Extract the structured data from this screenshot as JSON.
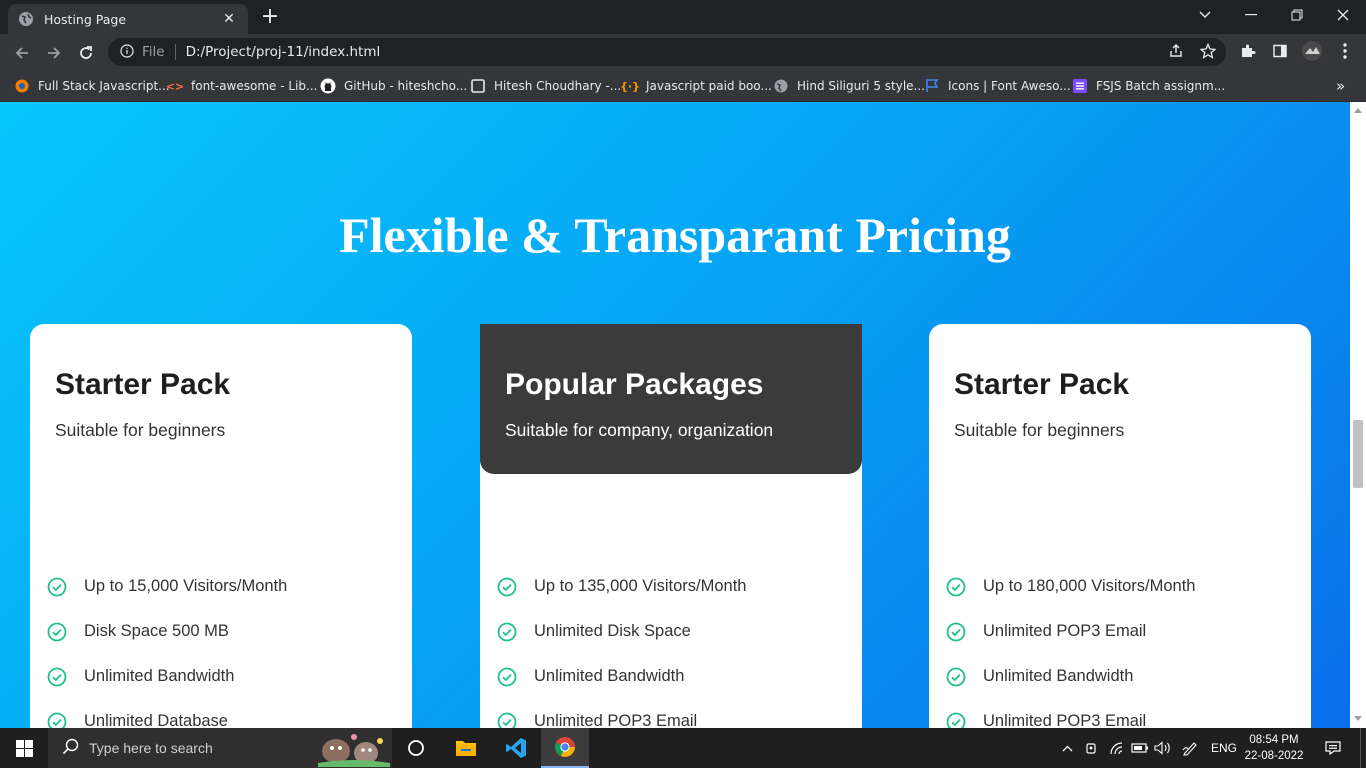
{
  "browser": {
    "tab_title": "Hosting Page",
    "address_file_label": "File",
    "address_url": "D:/Project/proj-11/index.html",
    "bookmarks": [
      {
        "label": "Full Stack Javascript...",
        "icon": "orange-circle-icon"
      },
      {
        "label": "font-awesome - Lib...",
        "icon": "code-brackets-icon"
      },
      {
        "label": "GitHub - hiteshcho...",
        "icon": "github-icon"
      },
      {
        "label": "Hitesh Choudhary -...",
        "icon": "square-icon"
      },
      {
        "label": "Javascript paid boo...",
        "icon": "curly-braces-icon"
      },
      {
        "label": "Hind Siliguri 5 style...",
        "icon": "globe-icon"
      },
      {
        "label": "Icons | Font Aweso...",
        "icon": "flag-icon"
      },
      {
        "label": "FSJS Batch assignm...",
        "icon": "list-icon"
      }
    ],
    "bookmarks_more": "»"
  },
  "page": {
    "heading": "Flexible & Transparant Pricing",
    "cards": [
      {
        "title": "Starter Pack",
        "subtitle": "Suitable for beginners",
        "highlighted": false,
        "features": [
          "Up to 15,000 Visitors/Month",
          "Disk Space 500 MB",
          "Unlimited Bandwidth",
          "Unlimited Database"
        ]
      },
      {
        "title": "Popular Packages",
        "subtitle": "Suitable for company, organization",
        "highlighted": true,
        "features": [
          "Up to 135,000 Visitors/Month",
          "Unlimited Disk Space",
          "Unlimited Bandwidth",
          "Unlimited POP3 Email"
        ]
      },
      {
        "title": "Starter Pack",
        "subtitle": "Suitable for beginners",
        "highlighted": false,
        "features": [
          "Up to 180,000 Visitors/Month",
          "Unlimited POP3 Email",
          "Unlimited Bandwidth",
          "Unlimited POP3 Email"
        ]
      }
    ],
    "colors": {
      "gradient_start": "#08c6fa",
      "gradient_end": "#0a6fea",
      "check_green": "#1fc08e",
      "popular_header": "#3b3b3b"
    }
  },
  "taskbar": {
    "search_placeholder": "Type here to search",
    "language": "ENG",
    "time": "08:54 PM",
    "date": "22-08-2022"
  }
}
